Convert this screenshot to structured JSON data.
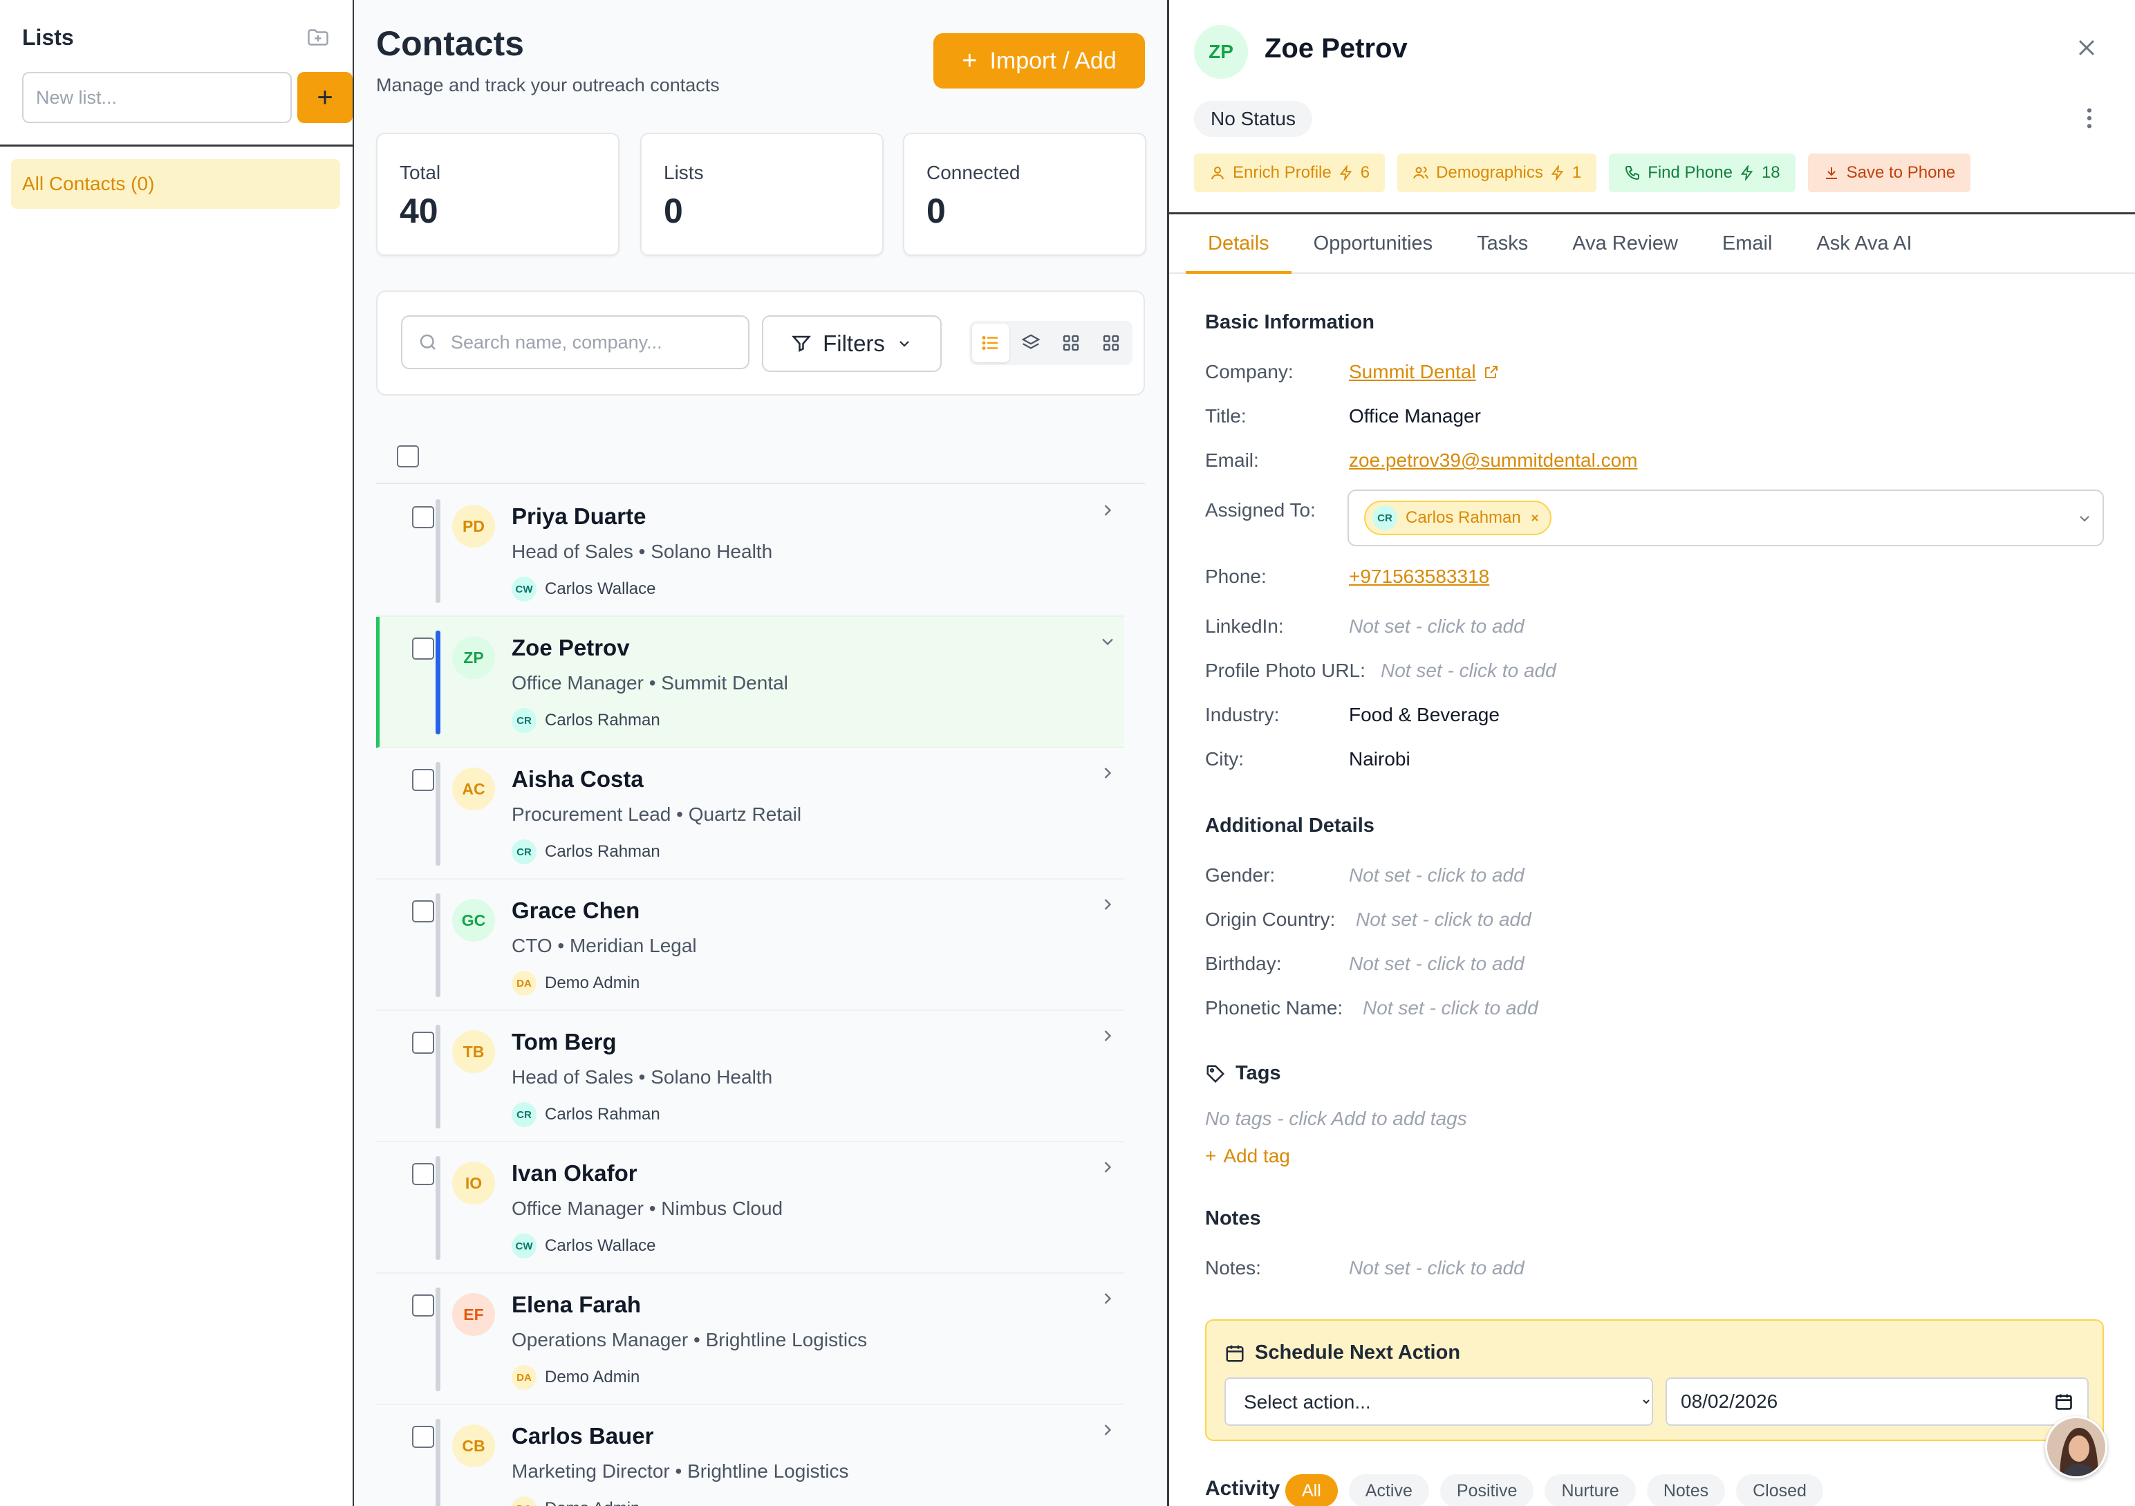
{
  "sidebar": {
    "title": "Lists",
    "new_list_placeholder": "New list...",
    "add_label": "+",
    "all_contacts": "All Contacts (0)"
  },
  "contacts": {
    "title": "Contacts",
    "subtitle": "Manage and track your outreach contacts",
    "import_label": "Import / Add",
    "stats": [
      {
        "label": "Total",
        "value": "40"
      },
      {
        "label": "Lists",
        "value": "0"
      },
      {
        "label": "Connected",
        "value": "0"
      }
    ],
    "search_placeholder": "Search name, company...",
    "filters_label": "Filters",
    "rows": [
      {
        "initials": "PD",
        "name": "Priya Duarte",
        "sub": "Head of Sales • Solano Health",
        "owner_initials": "CW",
        "owner": "Carlos Wallace"
      },
      {
        "initials": "ZP",
        "name": "Zoe Petrov",
        "sub": "Office Manager • Summit Dental",
        "owner_initials": "CR",
        "owner": "Carlos Rahman"
      },
      {
        "initials": "AC",
        "name": "Aisha Costa",
        "sub": "Procurement Lead • Quartz Retail",
        "owner_initials": "CR",
        "owner": "Carlos Rahman"
      },
      {
        "initials": "GC",
        "name": "Grace Chen",
        "sub": "CTO • Meridian Legal",
        "owner_initials": "DA",
        "owner": "Demo Admin"
      },
      {
        "initials": "TB",
        "name": "Tom Berg",
        "sub": "Head of Sales • Solano Health",
        "owner_initials": "CR",
        "owner": "Carlos Rahman"
      },
      {
        "initials": "IO",
        "name": "Ivan Okafor",
        "sub": "Office Manager • Nimbus Cloud",
        "owner_initials": "CW",
        "owner": "Carlos Wallace"
      },
      {
        "initials": "EF",
        "name": "Elena Farah",
        "sub": "Operations Manager • Brightline Logistics",
        "owner_initials": "DA",
        "owner": "Demo Admin"
      },
      {
        "initials": "CB",
        "name": "Carlos Bauer",
        "sub": "Marketing Director • Brightline Logistics",
        "owner_initials": "DA",
        "owner": "Demo Admin"
      }
    ]
  },
  "detail": {
    "initials": "ZP",
    "name": "Zoe Petrov",
    "status": "No Status",
    "chips": {
      "enrich": "Enrich Profile",
      "enrich_count": "6",
      "demographics": "Demographics",
      "demographics_count": "1",
      "find_phone": "Find Phone",
      "find_phone_count": "18",
      "save_phone": "Save to Phone"
    },
    "tabs": [
      "Details",
      "Opportunities",
      "Tasks",
      "Ava Review",
      "Email",
      "Ask Ava AI"
    ],
    "basic_title": "Basic Information",
    "labels": {
      "company": "Company:",
      "title": "Title:",
      "email": "Email:",
      "assigned": "Assigned To:",
      "phone": "Phone:",
      "linkedin": "LinkedIn:",
      "photo": "Profile Photo URL:",
      "industry": "Industry:",
      "city": "City:",
      "gender": "Gender:",
      "origin": "Origin Country:",
      "birthday": "Birthday:",
      "phonetic": "Phonetic Name:",
      "notes": "Notes:"
    },
    "values": {
      "company": "Summit Dental",
      "title": "Office Manager",
      "email": "zoe.petrov39@summitdental.com",
      "assigned_initials": "CR",
      "assigned": "Carlos Rahman",
      "phone": "+971563583318",
      "industry": "Food & Beverage",
      "city": "Nairobi"
    },
    "not_set": "Not set - click to add",
    "additional_title": "Additional Details",
    "tags_title": "Tags",
    "no_tags": "No tags - click Add to add tags",
    "add_tag": "Add tag",
    "notes_title": "Notes",
    "schedule_title": "Schedule Next Action",
    "schedule_select": "Select action...",
    "schedule_date": "08/02/2026",
    "activity_label": "Activity",
    "activity_filters": [
      "All",
      "Active",
      "Positive",
      "Nurture",
      "Notes",
      "Closed"
    ]
  },
  "colors": {
    "accent": "#f59e0b",
    "accent_text": "#d98a06",
    "selected_row": "#effbf1",
    "selected_bar": "#2563eb"
  }
}
